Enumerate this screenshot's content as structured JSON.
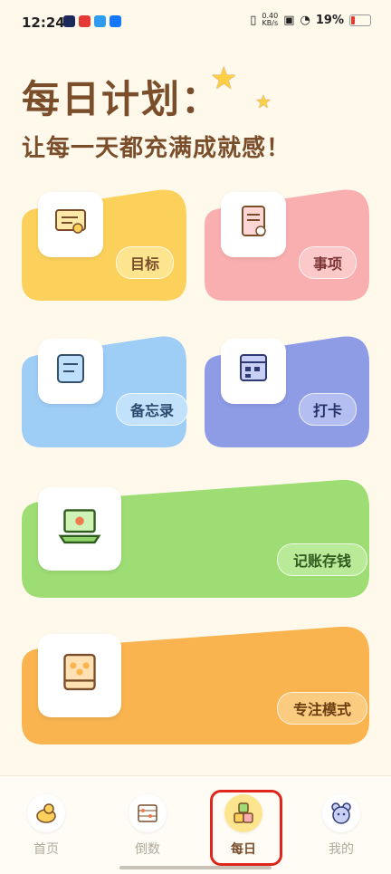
{
  "status": {
    "time": "12:24",
    "net_speed": "0.40",
    "net_unit": "KB/s",
    "battery": "19%"
  },
  "header": {
    "title": "每日计划：",
    "subtitle": "让每一天都充满成就感！"
  },
  "cards": {
    "goal": "目标",
    "todo": "事项",
    "memo": "备忘录",
    "checkin": "打卡",
    "bookkeeping": "记账存钱",
    "focus": "专注模式"
  },
  "nav": {
    "home": "首页",
    "countdown": "倒数",
    "daily": "每日",
    "mine": "我的"
  },
  "colors": {
    "yellow": "#FCD15B",
    "pink": "#F9AFAF",
    "blue": "#9ECDF6",
    "indigo": "#8E9CE6",
    "green": "#9DDD73",
    "orange": "#F9B34F",
    "brown": "#7A4E2A"
  }
}
